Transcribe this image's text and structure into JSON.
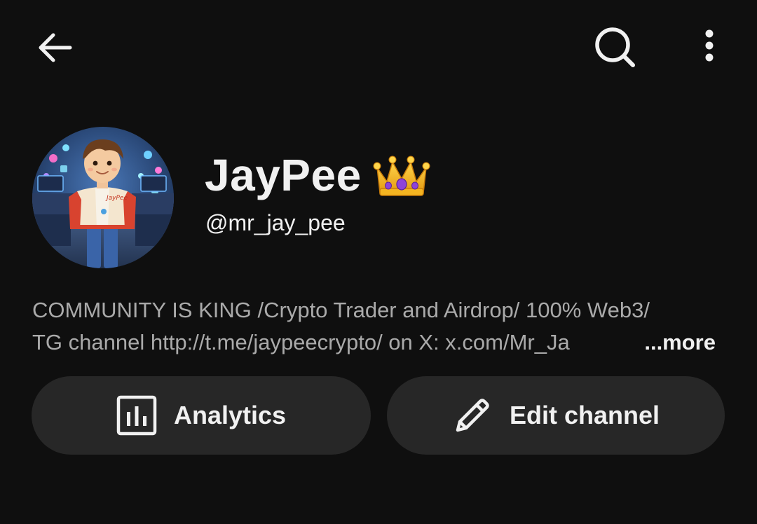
{
  "topbar": {
    "back_icon": "arrow-left-icon",
    "search_icon": "search-icon",
    "more_icon": "more-vertical-icon"
  },
  "channel": {
    "name": "JayPee",
    "name_emoji": "crown-emoji",
    "handle": "@mr_jay_pee",
    "avatar": "avatar-cartoon-boy-jacket"
  },
  "description": {
    "line1": "COMMUNITY IS KING /Crypto Trader and Airdrop/ 100% Web3/",
    "line2": "TG channel http://t.me/jaypeecrypto/ on X: x.com/Mr_Ja",
    "more_label": "...more"
  },
  "actions": {
    "analytics_label": "Analytics",
    "analytics_icon": "analytics-icon",
    "edit_label": "Edit channel",
    "edit_icon": "pencil-icon"
  },
  "colors": {
    "background": "#0f0f0f",
    "text_primary": "#f1f1f1",
    "text_secondary": "#aaaaaa",
    "button_bg": "#272727"
  }
}
